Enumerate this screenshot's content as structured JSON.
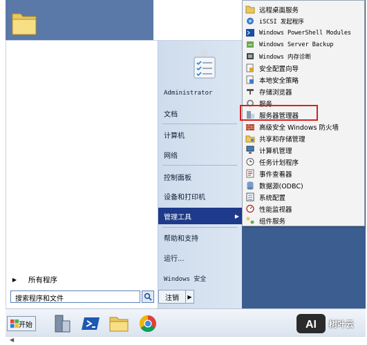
{
  "start_menu": {
    "all_programs_label": "所有程序",
    "search_placeholder": "搜索程序和文件",
    "right_pane": {
      "user": "Administrator",
      "items": [
        "文档",
        "计算机",
        "网络",
        "控制面板",
        "设备和打印机",
        "管理工具",
        "帮助和支持",
        "运行...",
        "Windows 安全"
      ],
      "selected": "管理工具",
      "shutdown_label": "注销"
    }
  },
  "admin_tools_submenu": {
    "items": [
      "远程桌面服务",
      "iSCSI 发起程序",
      "Windows PowerShell Modules",
      "Windows Server Backup",
      "Windows 内存诊断",
      "安全配置向导",
      "本地安全策略",
      "存储浏览器",
      "服务",
      "服务器管理器",
      "高级安全 Windows 防火墙",
      "共享和存储管理",
      "计算机管理",
      "任务计划程序",
      "事件查看器",
      "数据源(ODBC)",
      "系统配置",
      "性能监视器",
      "组件服务"
    ],
    "highlighted": "服务器管理器"
  },
  "taskbar": {
    "start_label": "开始",
    "apps": [
      "server-manager",
      "powershell",
      "explorer",
      "chrome"
    ]
  },
  "watermark": {
    "logo_text": "AI",
    "name": "树叶云"
  }
}
